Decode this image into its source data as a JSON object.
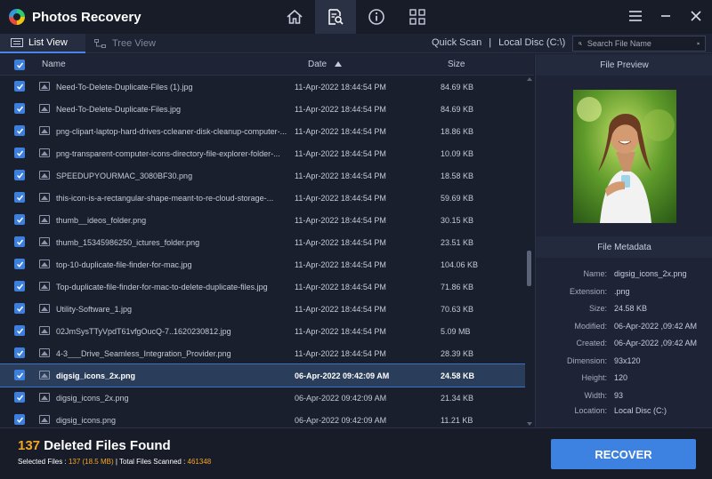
{
  "app": {
    "title": "Photos Recovery"
  },
  "nav": [
    {
      "name": "home-icon",
      "active": false
    },
    {
      "name": "scan-document-icon",
      "active": true
    },
    {
      "name": "info-icon",
      "active": false
    },
    {
      "name": "grid-icon",
      "active": false
    }
  ],
  "toolbar": {
    "list_view": "List View",
    "tree_view": "Tree View",
    "scan_mode": "Quick Scan",
    "separator": "|",
    "location": "Local Disc (C:\\)",
    "search_placeholder": "Search File Name"
  },
  "columns": {
    "name": "Name",
    "date": "Date",
    "size": "Size"
  },
  "files": [
    {
      "name": "Need-To-Delete-Duplicate-Files (1).jpg",
      "date": "11-Apr-2022 18:44:54 PM",
      "size": "84.69 KB"
    },
    {
      "name": "Need-To-Delete-Duplicate-Files.jpg",
      "date": "11-Apr-2022 18:44:54 PM",
      "size": "84.69 KB"
    },
    {
      "name": "png-clipart-laptop-hard-drives-ccleaner-disk-cleanup-computer-...",
      "date": "11-Apr-2022 18:44:54 PM",
      "size": "18.86 KB"
    },
    {
      "name": "png-transparent-computer-icons-directory-file-explorer-folder-...",
      "date": "11-Apr-2022 18:44:54 PM",
      "size": "10.09 KB"
    },
    {
      "name": "SPEEDUPYOURMAC_3080BF30.png",
      "date": "11-Apr-2022 18:44:54 PM",
      "size": "18.58 KB"
    },
    {
      "name": "this-icon-is-a-rectangular-shape-meant-to-re-cloud-storage-...",
      "date": "11-Apr-2022 18:44:54 PM",
      "size": "59.69 KB"
    },
    {
      "name": "thumb__ideos_folder.png",
      "date": "11-Apr-2022 18:44:54 PM",
      "size": "30.15 KB"
    },
    {
      "name": "thumb_15345986250_ictures_folder.png",
      "date": "11-Apr-2022 18:44:54 PM",
      "size": "23.51 KB"
    },
    {
      "name": "top-10-duplicate-file-finder-for-mac.jpg",
      "date": "11-Apr-2022 18:44:54 PM",
      "size": "104.06 KB"
    },
    {
      "name": "Top-duplicate-file-finder-for-mac-to-delete-duplicate-files.jpg",
      "date": "11-Apr-2022 18:44:54 PM",
      "size": "71.86 KB"
    },
    {
      "name": "Utility-Software_1.jpg",
      "date": "11-Apr-2022 18:44:54 PM",
      "size": "70.63 KB"
    },
    {
      "name": "02JmSysTTyVpdT61vfgOucQ-7..1620230812.jpg",
      "date": "11-Apr-2022 18:44:54 PM",
      "size": "5.09 MB"
    },
    {
      "name": "4-3___Drive_Seamless_Integration_Provider.png",
      "date": "11-Apr-2022 18:44:54 PM",
      "size": "28.39 KB"
    },
    {
      "name": "digsig_icons_2x.png",
      "date": "06-Apr-2022 09:42:09 AM",
      "size": "24.58 KB",
      "selected": true
    },
    {
      "name": "digsig_icons_2x.png",
      "date": "06-Apr-2022 09:42:09 AM",
      "size": "21.34 KB"
    },
    {
      "name": "digsig_icons.png",
      "date": "06-Apr-2022 09:42:09 AM",
      "size": "11.21 KB"
    }
  ],
  "preview": {
    "title": "File Preview",
    "metadata_title": "File Metadata",
    "metadata": [
      {
        "key": "Name:",
        "value": "digsig_icons_2x.png"
      },
      {
        "key": "Extension:",
        "value": ".png"
      },
      {
        "key": "Size:",
        "value": "24.58 KB"
      },
      {
        "key": "Modified:",
        "value": "06-Apr-2022 ,09:42 AM"
      },
      {
        "key": "Created:",
        "value": "06-Apr-2022 ,09:42 AM"
      },
      {
        "key": "Dimension:",
        "value": "93x120"
      },
      {
        "key": "Height:",
        "value": "120"
      },
      {
        "key": "Width:",
        "value": "93"
      },
      {
        "key": "Location:",
        "value": "Local Disc (C:)"
      }
    ]
  },
  "footer": {
    "found_count": "137",
    "found_label": "Deleted Files Found",
    "selected_label": "Selected Files :",
    "selected_value": "137 (18.5 MB)",
    "sep": "|",
    "scanned_label": "Total Files Scanned :",
    "scanned_value": "461348",
    "recover_label": "RECOVER"
  },
  "colors": {
    "accent": "#3d82e0",
    "highlight": "#f5a623",
    "background": "#1a1f2e"
  }
}
